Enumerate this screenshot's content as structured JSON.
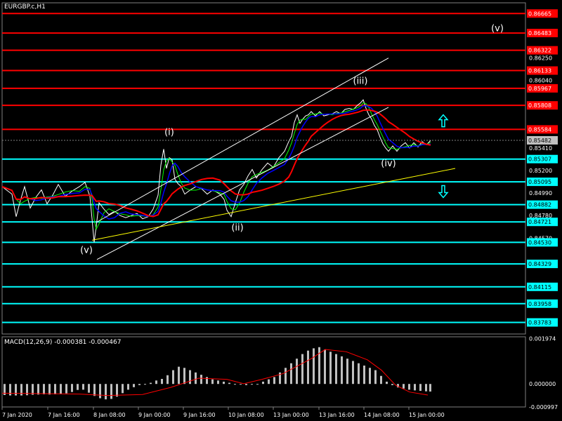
{
  "header": {
    "symbol": "EURGBP.c,H1"
  },
  "macd_header": {
    "label": "MACD(12,26,9) -0.000381 -0.000467"
  },
  "colors": {
    "background": "#000000",
    "resistance": "#ff0000",
    "support": "#00ffff",
    "price_tag_red": "#ff0000",
    "price_tag_cyan": "#00ffff",
    "price": "#ffffff",
    "channel": "#ffffff",
    "ma_fast": "#0000ff",
    "ma_slow": "#ff0000",
    "ma_slowest": "#00ff00",
    "trend": "#ffff00",
    "macd_hist": "#c0c0c0",
    "macd_signal": "#ff0000"
  },
  "chart_data": [
    {
      "type": "line",
      "symbol": "EURGBP.c,H1",
      "ylim": [
        0.83675,
        0.86765
      ],
      "y_ticks": [
        0.8625,
        0.8604,
        0.8541,
        0.852,
        0.8499,
        0.8478,
        0.8457
      ],
      "x_ticks": [
        "7 Jan 2020",
        "7 Jan 16:00",
        "8 Jan 08:00",
        "9 Jan 00:00",
        "9 Jan 16:00",
        "10 Jan 08:00",
        "13 Jan 00:00",
        "13 Jan 16:00",
        "14 Jan 08:00",
        "15 Jan 00:00"
      ],
      "current_price": 0.85482,
      "resistance_levels": [
        0.86665,
        0.86483,
        0.86322,
        0.86133,
        0.85967,
        0.85808,
        0.85584
      ],
      "support_levels": [
        0.85307,
        0.85095,
        0.84882,
        0.84721,
        0.8453,
        0.84329,
        0.84115,
        0.83958,
        0.83783
      ],
      "wave_labels": [
        {
          "label": "(v)",
          "x_bar": 120,
          "y": 0.8443
        },
        {
          "label": "(i)",
          "x_bar": 238,
          "y": 0.8553
        },
        {
          "label": "(ii)",
          "x_bar": 335,
          "y": 0.8464
        },
        {
          "label": "(iii)",
          "x_bar": 510,
          "y": 0.8601
        },
        {
          "label": "(iv)",
          "x_bar": 550,
          "y": 0.8524
        },
        {
          "label": "(v)",
          "x_bar": 705,
          "y": 0.865
        }
      ],
      "price_series": {
        "bar": [
          0,
          14,
          20,
          26,
          32,
          40,
          48,
          56,
          64,
          72,
          80,
          90,
          100,
          110,
          118,
          125,
          128,
          131,
          134,
          138,
          145,
          152,
          160,
          168,
          176,
          184,
          192,
          200,
          208,
          215,
          222,
          226,
          230,
          234,
          238,
          242,
          246,
          250,
          255,
          260,
          268,
          276,
          284,
          292,
          300,
          310,
          316,
          320,
          326,
          332,
          338,
          344,
          350,
          356,
          362,
          370,
          378,
          386,
          394,
          402,
          408,
          412,
          416,
          420,
          424,
          428,
          432,
          436,
          440,
          446,
          452,
          458,
          464,
          470,
          476,
          482,
          488,
          494,
          500,
          506,
          510,
          514,
          518,
          522,
          526,
          530,
          534,
          538,
          542,
          546,
          550,
          556,
          562,
          568,
          574,
          580,
          586,
          592,
          598,
          604,
          610
        ],
        "value": [
          0.8505,
          0.8498,
          0.8477,
          0.8492,
          0.8505,
          0.8485,
          0.8495,
          0.8502,
          0.8489,
          0.8497,
          0.8507,
          0.8496,
          0.8501,
          0.8505,
          0.8509,
          0.8496,
          0.8475,
          0.8453,
          0.8468,
          0.849,
          0.8484,
          0.8479,
          0.8482,
          0.8478,
          0.8476,
          0.8478,
          0.848,
          0.8475,
          0.8477,
          0.8484,
          0.8497,
          0.8525,
          0.854,
          0.8522,
          0.8532,
          0.853,
          0.8512,
          0.8508,
          0.8505,
          0.8498,
          0.8502,
          0.8505,
          0.8503,
          0.8498,
          0.8502,
          0.8498,
          0.8493,
          0.8483,
          0.8477,
          0.849,
          0.8502,
          0.8507,
          0.8515,
          0.8521,
          0.8513,
          0.8521,
          0.8527,
          0.8523,
          0.8532,
          0.8538,
          0.8547,
          0.8552,
          0.8565,
          0.8572,
          0.8564,
          0.8568,
          0.8571,
          0.8572,
          0.8575,
          0.8571,
          0.8575,
          0.8571,
          0.8572,
          0.8573,
          0.8575,
          0.8573,
          0.8577,
          0.8578,
          0.8577,
          0.8581,
          0.8583,
          0.8586,
          0.8578,
          0.8572,
          0.8568,
          0.8562,
          0.8558,
          0.8551,
          0.8545,
          0.8541,
          0.8538,
          0.8543,
          0.8538,
          0.8543,
          0.8546,
          0.8541,
          0.8546,
          0.8542,
          0.8547,
          0.8544,
          0.8548
        ]
      }
    },
    {
      "type": "bar",
      "name": "MACD(12,26,9)",
      "main": -0.000381,
      "signal": -0.000467,
      "ylim": [
        -0.001,
        0.00205
      ],
      "y_ticks": [
        0.001974,
        0.0,
        -0.000997
      ],
      "hist_bar": [
        0,
        8,
        16,
        24,
        32,
        40,
        48,
        56,
        64,
        72,
        80,
        88,
        96,
        104,
        112,
        120,
        128,
        136,
        144,
        152,
        160,
        168,
        176,
        184,
        192,
        200,
        208,
        216,
        224,
        232,
        240,
        248,
        256,
        264,
        272,
        280,
        288,
        296,
        304,
        312,
        320,
        328,
        336,
        344,
        352,
        360,
        368,
        376,
        384,
        392,
        400,
        408,
        416,
        424,
        432,
        440,
        448,
        456,
        464,
        472,
        480,
        488,
        496,
        504,
        512,
        520,
        528,
        536,
        544,
        552,
        560,
        568,
        576,
        584,
        592,
        600,
        606
      ],
      "hist": [
        -0.00048,
        -0.0005,
        -0.0005,
        -0.0005,
        -0.00049,
        -0.00047,
        -0.00046,
        -0.00045,
        -0.00046,
        -0.00045,
        -0.00044,
        -0.00041,
        -0.00035,
        -0.00026,
        -0.00025,
        -0.00038,
        -0.00052,
        -0.00062,
        -0.00067,
        -0.00065,
        -0.00055,
        -0.0004,
        -0.00025,
        -0.00014,
        -5e-05,
        0.0,
        5e-05,
        0.00015,
        0.00022,
        0.00038,
        0.0006,
        0.00075,
        0.0007,
        0.0006,
        0.0005,
        0.0004,
        0.0003,
        0.0002,
        0.00015,
        0.0001,
        5e-05,
        0.0,
        -3e-05,
        -5e-05,
        -3e-05,
        0.0,
        0.0001,
        0.0002,
        0.0003,
        0.0005,
        0.0007,
        0.0009,
        0.0011,
        0.0013,
        0.00145,
        0.00155,
        0.0016,
        0.0015,
        0.0014,
        0.0013,
        0.0012,
        0.0011,
        0.001,
        0.0009,
        0.0008,
        0.0007,
        0.0006,
        0.00035,
        0.0001,
        -5e-05,
        -0.00015,
        -0.0002,
        -0.00025,
        -0.00028,
        -0.0003,
        -0.00032,
        -0.00033
      ],
      "signal_bar": [
        0,
        60,
        110,
        150,
        200,
        240,
        280,
        320,
        344,
        370,
        400,
        440,
        460,
        490,
        520,
        540,
        560,
        580,
        606
      ],
      "signal_line": [
        -0.0004,
        -0.00042,
        -0.00044,
        -0.0005,
        -0.00046,
        -0.00015,
        0.00025,
        0.0002,
        1e-05,
        0.0002,
        0.00045,
        0.0011,
        0.0015,
        0.0014,
        0.00105,
        0.0006,
        -5e-05,
        -0.00035,
        -0.00048
      ]
    }
  ]
}
